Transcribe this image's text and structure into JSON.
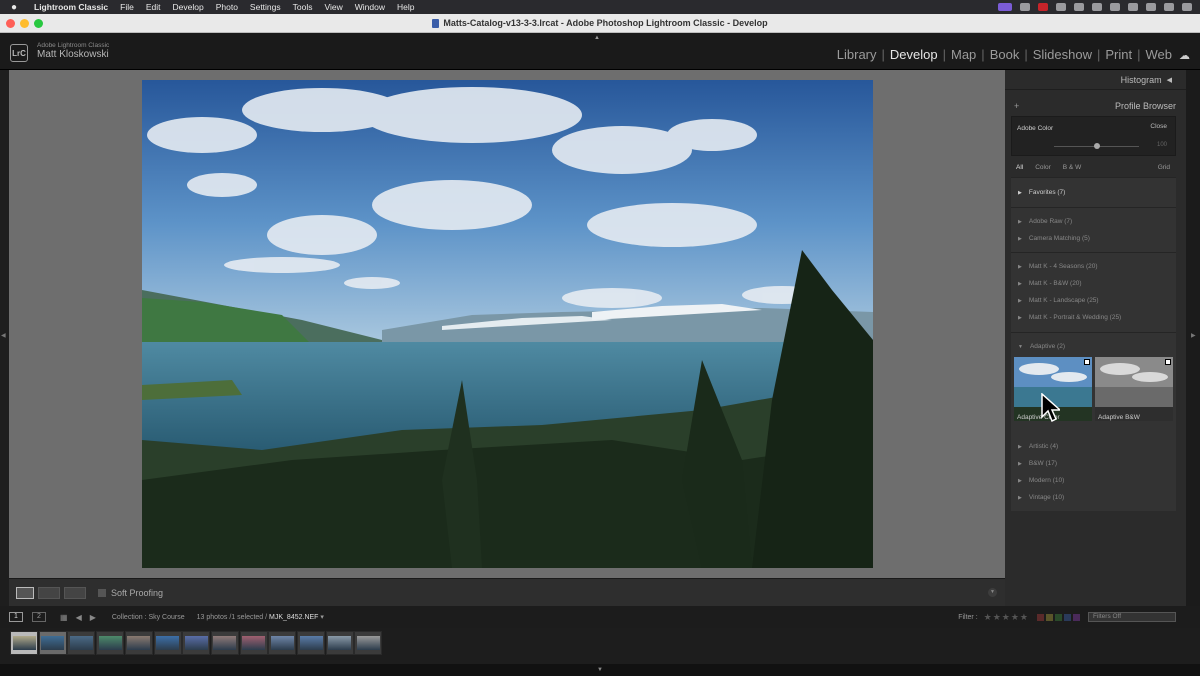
{
  "menubar": {
    "apple": "",
    "app": "Lightroom Classic",
    "items": [
      "File",
      "Edit",
      "Develop",
      "Photo",
      "Settings",
      "Tools",
      "View",
      "Window",
      "Help"
    ]
  },
  "window": {
    "title": "Matts-Catalog-v13-3-3.lrcat - Adobe Photoshop Lightroom Classic - Develop"
  },
  "identity": {
    "logo": "LrC",
    "product": "Adobe Lightroom Classic",
    "user": "Matt Kloskowski"
  },
  "modules": {
    "items": [
      "Library",
      "Develop",
      "Map",
      "Book",
      "Slideshow",
      "Print",
      "Web"
    ],
    "active": "Develop"
  },
  "toolbar": {
    "soft_proofing": "Soft Proofing"
  },
  "right_panel": {
    "histogram": "Histogram",
    "add": "+",
    "profile_browser": "Profile Browser",
    "current_profile": "Adobe Color",
    "close": "Close",
    "amount": "100",
    "filters": [
      "All",
      "Color",
      "B & W"
    ],
    "active_filter": "All",
    "view": "Grid",
    "groups": [
      {
        "items": [
          "Favorites (7)"
        ]
      },
      {
        "items": [
          "Adobe Raw (7)",
          "Camera Matching (5)"
        ]
      },
      {
        "items": [
          "Matt K - 4 Seasons (20)",
          "Matt K - B&W (20)",
          "Matt K - Landscape (25)",
          "Matt K - Portrait & Wedding (25)"
        ]
      },
      {
        "items": [
          "Adaptive (2)",
          "Artistic (4)",
          "B&W (17)",
          "Modern (10)",
          "Vintage (10)"
        ]
      }
    ],
    "adaptive_thumbs": [
      "Adaptive Color",
      "Adaptive B&W"
    ]
  },
  "filmstrip": {
    "page1": "1",
    "page2": "2",
    "collection": "Collection : Sky Course",
    "count": "13 photos /1 selected /",
    "filename": "MJK_8452.NEF",
    "filename_suffix": "▾",
    "filter_label": "Filter :",
    "filters_off": "Filters Off",
    "thumbnail_count": 13,
    "selected_index": 1
  },
  "colors": {
    "panel": "#2b2b2b",
    "canvas": "#6e6e6e",
    "menubar": "#2a2a2e",
    "titlebar": "#e9e9e9"
  },
  "icons": {
    "window_controls": [
      "close-dot",
      "minimize-dot",
      "zoom-dot"
    ],
    "cloud": "cloud-icon",
    "cursor": "pointer-cursor-icon"
  }
}
